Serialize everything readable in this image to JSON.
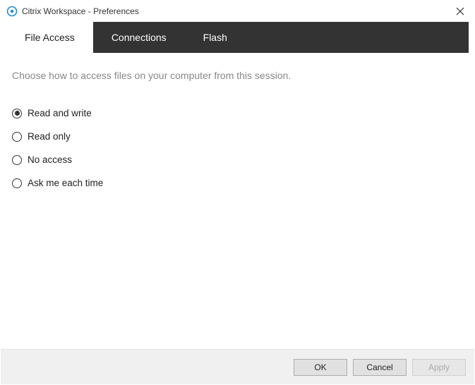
{
  "window": {
    "title": "Citrix Workspace - Preferences"
  },
  "tabs": {
    "file_access": "File Access",
    "connections": "Connections",
    "flash": "Flash"
  },
  "main": {
    "description": "Choose how to access files on your computer from this session."
  },
  "options": {
    "read_write": "Read and write",
    "read_only": "Read only",
    "no_access": "No access",
    "ask_each": "Ask me each time"
  },
  "buttons": {
    "ok": "OK",
    "cancel": "Cancel",
    "apply": "Apply"
  }
}
